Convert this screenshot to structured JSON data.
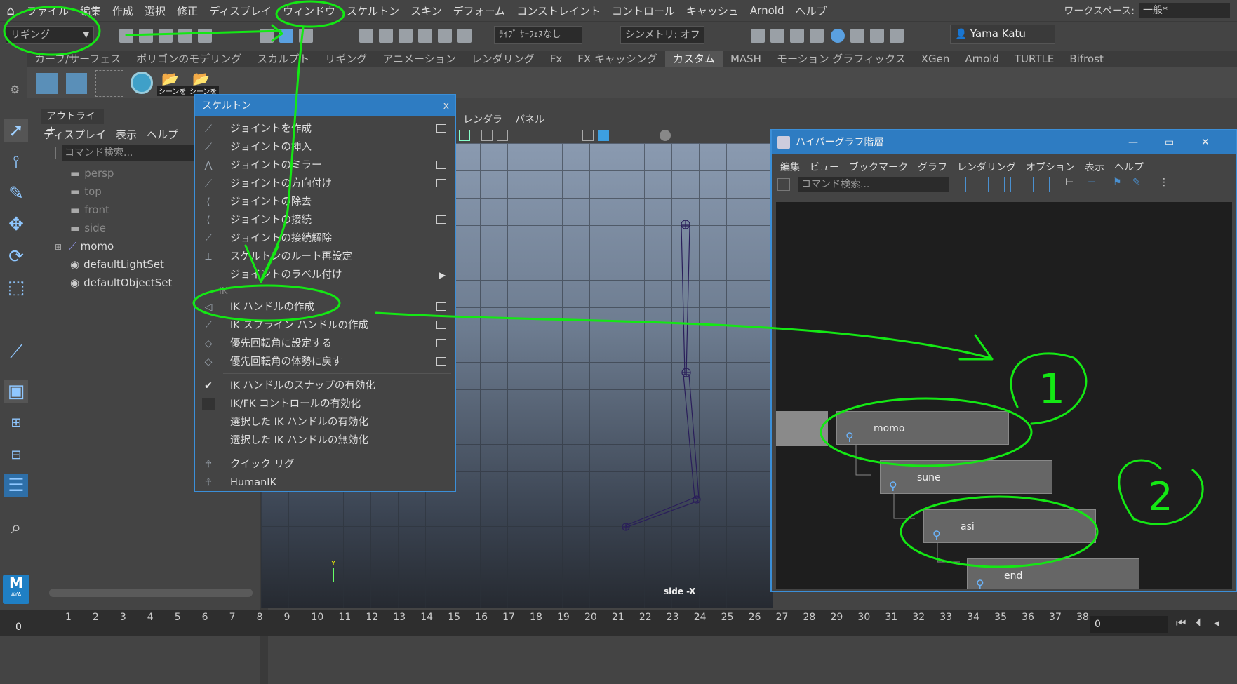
{
  "menubar": {
    "items": [
      "ファイル",
      "編集",
      "作成",
      "選択",
      "修正",
      "ディスプレイ",
      "ウィンドウ",
      "スケルトン",
      "スキン",
      "デフォーム",
      "コンストレイント",
      "コントロール",
      "キャッシュ",
      "Arnold",
      "ヘルプ"
    ],
    "workspace_label": "ワークスペース:",
    "workspace_value": "一般*"
  },
  "toolbar": {
    "mode": "リギング",
    "live_surface": "ﾗｲﾌﾞ ｻｰﾌｪｽなし",
    "symmetry": "シンメトリ: オフ",
    "user": "Yama Katu"
  },
  "shelf_tabs": [
    "カーブ/サーフェス",
    "ポリゴンのモデリング",
    "スカルプト",
    "リギング",
    "アニメーション",
    "レンダリング",
    "Fx",
    "FX キャッシング",
    "カスタム",
    "MASH",
    "モーション グラフィックス",
    "XGen",
    "Arnold",
    "TURTLE",
    "Bifrost"
  ],
  "shelf_tab_active": "カスタム",
  "shelf": {
    "label1": "シーンを",
    "label2": "シーンを"
  },
  "outliner": {
    "tab": "アウトライナ",
    "menu": [
      "ディスプレイ",
      "表示",
      "ヘルプ"
    ],
    "search_placeholder": "コマンド検索...",
    "items": [
      "persp",
      "top",
      "front",
      "side",
      "momo",
      "defaultLightSet",
      "defaultObjectSet"
    ]
  },
  "viewport": {
    "menu": [
      "レンダラ",
      "パネル"
    ],
    "label": "side -X",
    "axis": "Y"
  },
  "popup": {
    "title": "スケルトン",
    "close": "x",
    "items": [
      "ジョイントを作成",
      "ジョイントの挿入",
      "ジョイントのミラー",
      "ジョイントの方向付け",
      "ジョイントの除去",
      "ジョイントの接続",
      "ジョイントの接続解除",
      "スケルトンのルート再設定",
      "ジョイントのラベル付け"
    ],
    "section_ik": "IK",
    "ik_items": [
      "IK ハンドルの作成",
      "IK スプライン ハンドルの作成",
      "優先回転角に設定する",
      "優先回転角の体勢に戻す"
    ],
    "toggles": [
      "IK ハンドルのスナップの有効化",
      "IK/FK コントロールの有効化",
      "選択した IK ハンドルの有効化",
      "選択した IK ハンドルの無効化"
    ],
    "rig_items": [
      "クイック リグ",
      "HumanIK"
    ]
  },
  "hypergraph": {
    "title": "ハイパーグラフ階層",
    "menu": [
      "編集",
      "ビュー",
      "ブックマーク",
      "グラフ",
      "レンダリング",
      "オプション",
      "表示",
      "ヘルプ"
    ],
    "search_placeholder": "コマンド検索...",
    "nodes": [
      "momo",
      "sune",
      "asi",
      "end"
    ]
  },
  "timeline": {
    "frames": [
      "0",
      "1",
      "2",
      "3",
      "4",
      "5",
      "6",
      "7",
      "8",
      "9",
      "10",
      "11",
      "12",
      "13",
      "14",
      "15",
      "16",
      "17",
      "18",
      "19",
      "20",
      "21",
      "22",
      "23",
      "24",
      "25",
      "26",
      "27",
      "28",
      "29",
      "30",
      "31",
      "32",
      "33",
      "34",
      "35",
      "36",
      "37",
      "38"
    ],
    "current": "0",
    "field": "0"
  },
  "annotations": {
    "one": "1",
    "two": "2"
  },
  "logo": {
    "m": "M",
    "aya": "AYA"
  }
}
